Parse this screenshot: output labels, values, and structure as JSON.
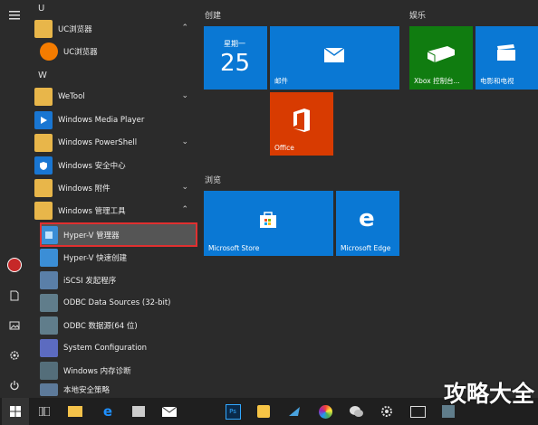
{
  "applist": {
    "header_u": "U",
    "header_w": "W",
    "items": [
      {
        "label": "UC浏览器"
      },
      {
        "label": "UC浏览器"
      },
      {
        "label": "WeTool"
      },
      {
        "label": "Windows Media Player"
      },
      {
        "label": "Windows PowerShell"
      },
      {
        "label": "Windows 安全中心"
      },
      {
        "label": "Windows 附件"
      },
      {
        "label": "Windows 管理工具"
      },
      {
        "label": "Hyper-V 管理器"
      },
      {
        "label": "Hyper-V 快速创建"
      },
      {
        "label": "iSCSI 发起程序"
      },
      {
        "label": "ODBC Data Sources (32-bit)"
      },
      {
        "label": "ODBC 数据源(64 位)"
      },
      {
        "label": "System Configuration"
      },
      {
        "label": "Windows 内存诊断"
      },
      {
        "label": "本地安全策略"
      }
    ]
  },
  "groups": {
    "create": "创建",
    "entertain": "娱乐",
    "browse": "浏览"
  },
  "tiles": {
    "calendar_day": "星期一",
    "calendar_date": "25",
    "mail": "邮件",
    "office": "Office",
    "xbox": "Xbox 控制台...",
    "movies": "电影和电视",
    "store": "Microsoft Store",
    "edge": "Microsoft Edge"
  },
  "watermark": "攻略大全",
  "colors": {
    "tile_blue": "#0a78d4",
    "office": "#d83b01",
    "xbox": "#107c10",
    "highlight": "#e03030"
  }
}
